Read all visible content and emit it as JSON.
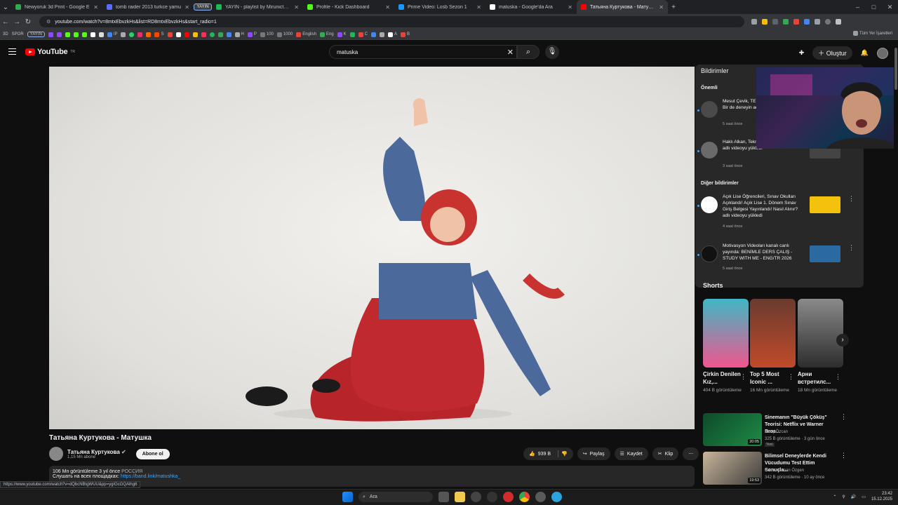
{
  "browser": {
    "tabs": [
      {
        "title": "Newyoruk 3d Print - Google E",
        "color": "#34a853"
      },
      {
        "title": "tomb raider 2013 turkce yamu",
        "color": "#5b6cff"
      },
      {
        "title": "YAYIN",
        "color": "#8ab4f8",
        "pinned": true
      },
      {
        "title": "YAYIN - playlist by Mirunicterb",
        "color": "#1db954"
      },
      {
        "title": "Profile - Kick Dashboard",
        "color": "#53fc18"
      },
      {
        "title": "Prime Video: Losb Sezon 1",
        "color": "#1a98ff"
      },
      {
        "title": "matuska - Google'da Ara",
        "color": "#ffffff"
      },
      {
        "title": "Татьяна Куртукова - Матушка",
        "color": "#ff0000",
        "active": true
      }
    ],
    "new_tab": "+",
    "url": "youtube.com/watch?v=8mtxEbvzkHs&list=RD8mtxEbvzkHs&start_radio=1",
    "bookmarks": [
      "3D",
      "SPOR",
      "YAYIN",
      "100",
      "1000",
      "English",
      "Eng",
      "K",
      "C",
      "A",
      "B",
      "IP",
      "S",
      "H",
      "P"
    ],
    "all_bookmarks": "Tüm Yer İşaretleri",
    "status_url": "https://www.youtube.com/watch?v=dQbcNBtgWUU&pp=ygIGcGQAlhg6"
  },
  "youtube": {
    "logo_text": "YouTube",
    "region": "TR",
    "search_value": "matuska",
    "create_label": "Oluştur"
  },
  "video": {
    "title": "Татьяна Куртукова - Матушка",
    "channel": "Татьяна Куртукова",
    "subscribers": "1,15 Mn abone",
    "subscribe_label": "Abone ol",
    "likes": "939 B",
    "share_label": "Paylaş",
    "save_label": "Kaydet",
    "clip_label": "Klip",
    "views_line": "106 Mn görüntüleme  3 yıl önce",
    "region_tag": "РОССИЯ",
    "desc_prefix": "Слушать на всех площадках:",
    "desc_link": "https://band.link/matushka_"
  },
  "notifications": {
    "title": "Bildirimler",
    "important_label": "Önemli",
    "other_label": "Diğer bildirimler",
    "items": [
      {
        "text": "Mesut Çevik, TEKNOLOJİ BİTTİ Mİ? Bir de deneyin adlı videoyu",
        "time": "5 saat önce"
      },
      {
        "text": "Haklı Alkan, Teknolojiyi nasıl aldım? adlı videoyu yükledi",
        "time": "3 saat önce"
      },
      {
        "text": "Açık Lise Öğrencileri, Sınav Okulları Açıklandı! Açık Lise 1. Dönem Sınav Giriş Belgesi Yayınlandı! Nasıl Alınır? adlı videoyu yükledi",
        "time": "4 saat önce"
      },
      {
        "text": "Motivasyon Videoları kanalı canlı yayında: BENİMLE DERS ÇALIŞ - STUDY WITH ME - ENG/TR 2026",
        "time": "5 saat önce"
      }
    ]
  },
  "shorts": {
    "title": "Shorts",
    "items": [
      {
        "title": "Çirkin Denilen Kız,...",
        "views": "404 B görüntüleme"
      },
      {
        "title": "Top 5 Most Iconic ...",
        "views": "16 Mn görüntüleme"
      },
      {
        "title": "Арни встретилс...",
        "views": "18 Mn görüntüleme"
      }
    ]
  },
  "related": [
    {
      "title": "Sinemanın \"Büyük Çöküş\" Teorisi: Netflix ve Warner Bros...",
      "channel": "Barış Özcan",
      "meta": "325 B görüntüleme · 3 gün önce",
      "badge": "Yeni",
      "duration": "20:05"
    },
    {
      "title": "Bilimsel Deneylerde Kendi Vücudumu Test Ettim Sonuçla...",
      "channel": "Cansu Canan Özgen",
      "meta": "342 B görüntüleme · 10 ay önce",
      "badge": "",
      "duration": "19:53"
    }
  ],
  "taskbar": {
    "search_placeholder": "Ara",
    "time": "23:42",
    "date": "15.12.2025"
  }
}
